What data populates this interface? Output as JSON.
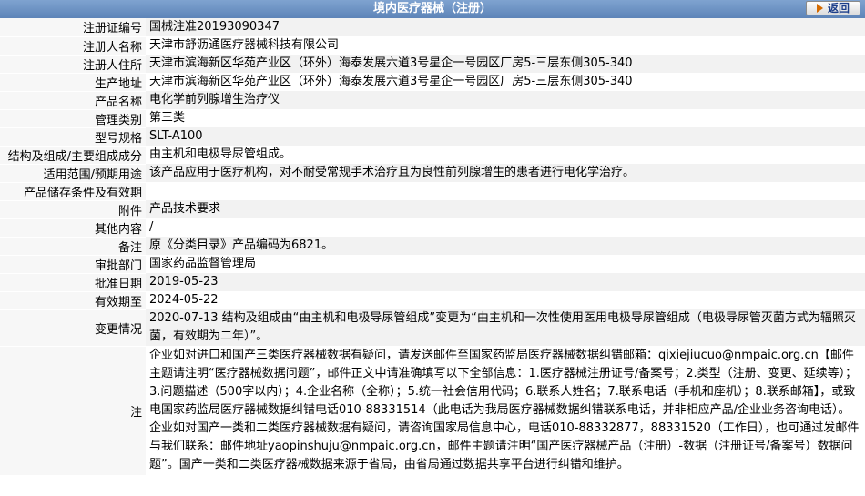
{
  "header": {
    "title": "境内医疗器械（注册）",
    "back_label": "返回"
  },
  "rows": [
    {
      "label": "注册证编号",
      "value": "国械注准20193090347"
    },
    {
      "label": "注册人名称",
      "value": "天津市舒沥通医疗器械科技有限公司"
    },
    {
      "label": "注册人住所",
      "value": "天津市滨海新区华苑产业区（环外）海泰发展六道3号星企一号园区厂房5-三层东侧305-340"
    },
    {
      "label": "生产地址",
      "value": "天津市滨海新区华苑产业区（环外）海泰发展六道3号星企一号园区厂房5-三层东侧305-340"
    },
    {
      "label": "产品名称",
      "value": "电化学前列腺增生治疗仪"
    },
    {
      "label": "管理类别",
      "value": "第三类"
    },
    {
      "label": "型号规格",
      "value": "SLT-A100"
    },
    {
      "label": "结构及组成/主要组成成分",
      "value": "由主机和电极导尿管组成。"
    },
    {
      "label": "适用范围/预期用途",
      "value": "该产品应用于医疗机构，对不耐受常规手术治疗且为良性前列腺增生的患者进行电化学治疗。"
    },
    {
      "label": "产品储存条件及有效期",
      "value": ""
    },
    {
      "label": "附件",
      "value": "产品技术要求"
    },
    {
      "label": "其他内容",
      "value": "/"
    },
    {
      "label": "备注",
      "value": "原《分类目录》产品编码为6821。"
    },
    {
      "label": "审批部门",
      "value": "国家药品监督管理局"
    },
    {
      "label": "批准日期",
      "value": "2019-05-23"
    },
    {
      "label": "有效期至",
      "value": "2024-05-22"
    },
    {
      "label": "变更情况",
      "value": "2020-07-13 结构及组成由“由主机和电极导尿管组成”变更为“由主机和一次性使用医用电极导尿管组成（电极导尿管灭菌方式为辐照灭菌，有效期为二年）”。"
    },
    {
      "label": "注",
      "value": "企业如对进口和国产三类医疗器械数据有疑问，请发送邮件至国家药监局医疗器械数据纠错邮箱：qixiejiucuo@nmpaic.org.cn【邮件主题请注明“医疗器械数据问题”，邮件正文中请准确填写以下全部信息：1.医疗器械注册证号/备案号；2.类型（注册、变更、延续等）；3.问题描述（500字以内）；4.企业名称（全称）；5.统一社会信用代码；6.联系人姓名；7.联系电话（手机和座机）；8.联系邮箱】，或致电国家药监局医疗器械数据纠错电话010-88331514（此电话为我局医疗器械数据纠错联系电话，并非相应产品/企业业务咨询电话）。企业如对国产一类和二类医疗器械数据有疑问，请咨询国家局信息中心，电话010-88332877，88331520（工作日），也可通过发邮件与我们联系：邮件地址yaopinshuju@nmpaic.org.cn，邮件主题请注明“国产医疗器械产品（注册）-数据（注册证号/备案号）数据问题”。国产一类和二类医疗器械数据来源于省局，由省局通过数据共享平台进行纠错和维护。"
    }
  ]
}
